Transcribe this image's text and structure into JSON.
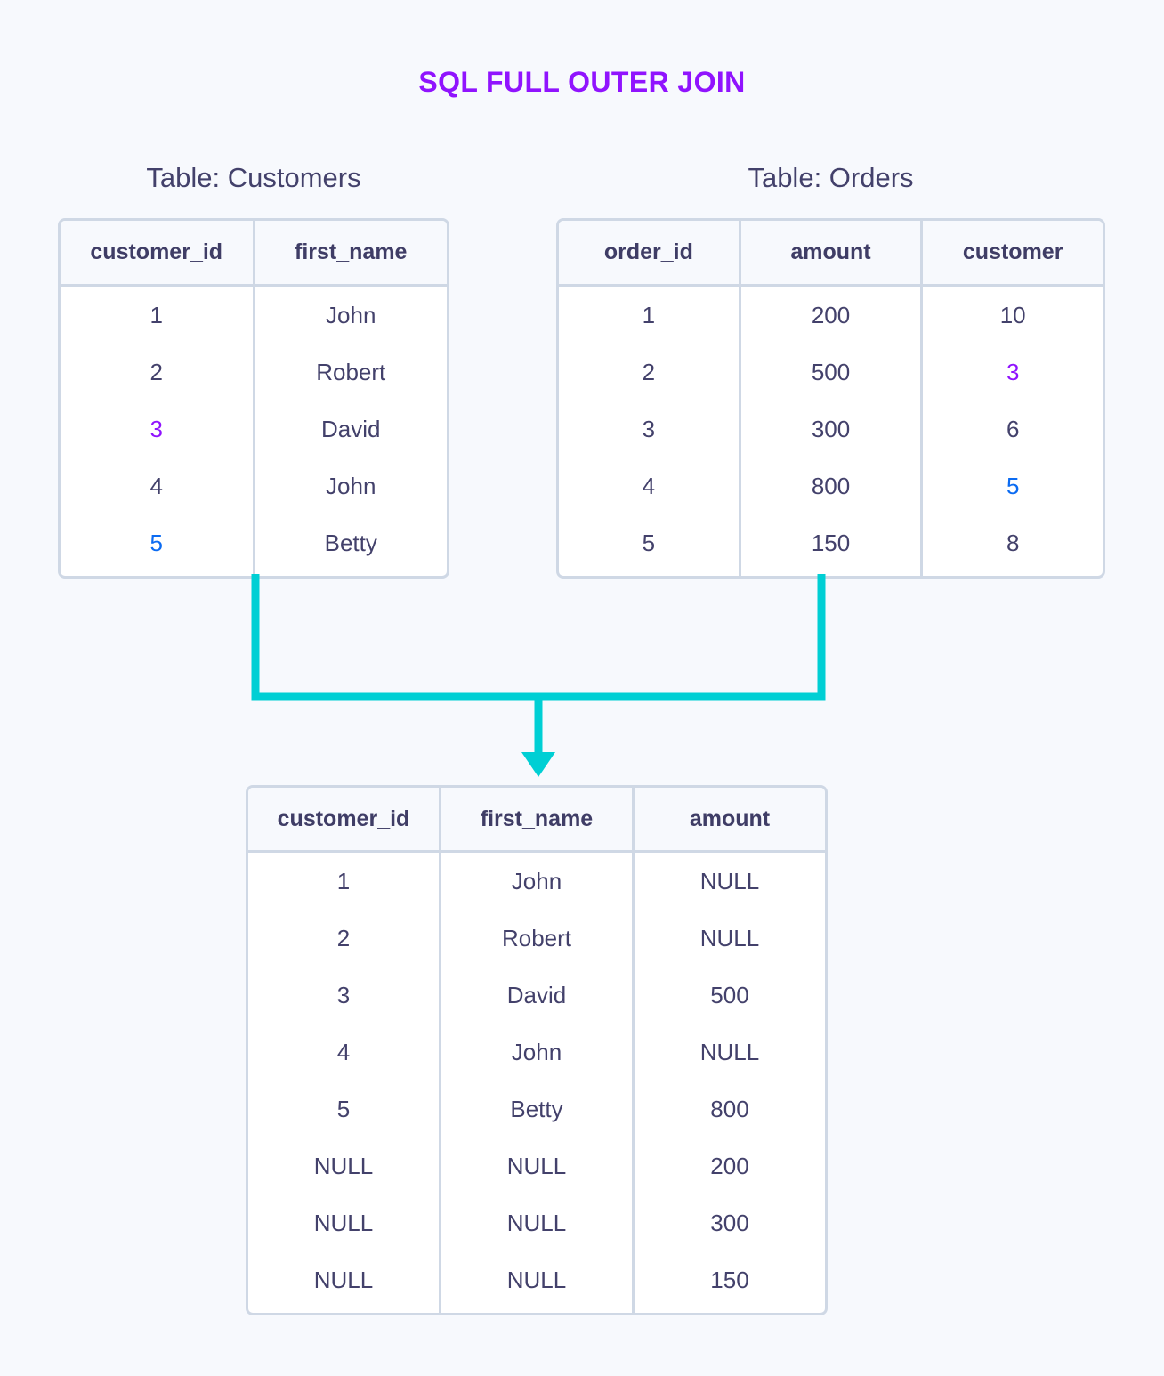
{
  "title": "SQL FULL OUTER JOIN",
  "colors": {
    "background": "#f7f9fd",
    "accent_purple": "#9013fe",
    "accent_blue": "#0b6bf2",
    "accent_cyan": "#00cfd4",
    "text_navy": "#43416b",
    "border": "#cfd8e5",
    "header_bg": "#f7f9fd"
  },
  "customers": {
    "title": "Table: Customers",
    "columns": [
      "customer_id",
      "first_name"
    ],
    "rows": [
      [
        {
          "v": "1",
          "c": "none"
        },
        {
          "v": "John",
          "c": "none"
        }
      ],
      [
        {
          "v": "2",
          "c": "none"
        },
        {
          "v": "Robert",
          "c": "none"
        }
      ],
      [
        {
          "v": "3",
          "c": "purple"
        },
        {
          "v": "David",
          "c": "none"
        }
      ],
      [
        {
          "v": "4",
          "c": "none"
        },
        {
          "v": "John",
          "c": "none"
        }
      ],
      [
        {
          "v": "5",
          "c": "blue"
        },
        {
          "v": "Betty",
          "c": "none"
        }
      ]
    ]
  },
  "orders": {
    "title": "Table: Orders",
    "columns": [
      "order_id",
      "amount",
      "customer"
    ],
    "rows": [
      [
        {
          "v": "1",
          "c": "none"
        },
        {
          "v": "200",
          "c": "none"
        },
        {
          "v": "10",
          "c": "none"
        }
      ],
      [
        {
          "v": "2",
          "c": "none"
        },
        {
          "v": "500",
          "c": "none"
        },
        {
          "v": "3",
          "c": "purple"
        }
      ],
      [
        {
          "v": "3",
          "c": "none"
        },
        {
          "v": "300",
          "c": "none"
        },
        {
          "v": "6",
          "c": "none"
        }
      ],
      [
        {
          "v": "4",
          "c": "none"
        },
        {
          "v": "800",
          "c": "none"
        },
        {
          "v": "5",
          "c": "blue"
        }
      ],
      [
        {
          "v": "5",
          "c": "none"
        },
        {
          "v": "150",
          "c": "none"
        },
        {
          "v": "8",
          "c": "none"
        }
      ]
    ]
  },
  "result": {
    "columns": [
      "customer_id",
      "first_name",
      "amount"
    ],
    "rows": [
      [
        {
          "v": "1",
          "c": "none"
        },
        {
          "v": "John",
          "c": "none"
        },
        {
          "v": "NULL",
          "c": "none"
        }
      ],
      [
        {
          "v": "2",
          "c": "none"
        },
        {
          "v": "Robert",
          "c": "none"
        },
        {
          "v": "NULL",
          "c": "none"
        }
      ],
      [
        {
          "v": "3",
          "c": "none"
        },
        {
          "v": "David",
          "c": "none"
        },
        {
          "v": "500",
          "c": "none"
        }
      ],
      [
        {
          "v": "4",
          "c": "none"
        },
        {
          "v": "John",
          "c": "none"
        },
        {
          "v": "NULL",
          "c": "none"
        }
      ],
      [
        {
          "v": "5",
          "c": "none"
        },
        {
          "v": "Betty",
          "c": "none"
        },
        {
          "v": "800",
          "c": "none"
        }
      ],
      [
        {
          "v": "NULL",
          "c": "none"
        },
        {
          "v": "NULL",
          "c": "none"
        },
        {
          "v": "200",
          "c": "none"
        }
      ],
      [
        {
          "v": "NULL",
          "c": "none"
        },
        {
          "v": "NULL",
          "c": "none"
        },
        {
          "v": "300",
          "c": "none"
        }
      ],
      [
        {
          "v": "NULL",
          "c": "none"
        },
        {
          "v": "NULL",
          "c": "none"
        },
        {
          "v": "150",
          "c": "none"
        }
      ]
    ]
  },
  "connector": {
    "icon": "join-arrow-down-icon",
    "color": "#00cfd4"
  }
}
